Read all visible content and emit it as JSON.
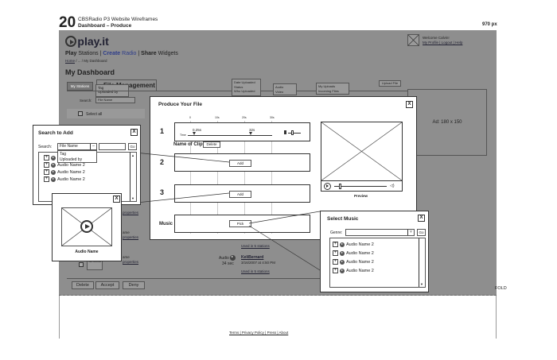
{
  "header": {
    "page_number": "20",
    "doc_title": "CBSRadio P3 Website Wireframes",
    "doc_subtitle": "Dashboard – Produce",
    "width_label": "970 px"
  },
  "site": {
    "logo_text": "play.it",
    "welcome": "Welcome Calvin!",
    "account_links": "My Profile | Logout | Help",
    "nav_play": "Play",
    "nav_stations": "Stations",
    "nav_create": "Create",
    "nav_radio": "Radio",
    "nav_share": "Share",
    "nav_widgets": "Widgets",
    "nav_sep": "|",
    "breadcrumb_home": "Home",
    "breadcrumb_rest": "/ ... / My Dashboard",
    "dashboard_title": "My Dashboard",
    "tab_stations": "My Stations",
    "tab_file_mgmt": "File Management",
    "tab_dropdown": [
      "Tag",
      "Uploaded by"
    ],
    "upload_date_items": [
      "Date Uploaded",
      "Status",
      "Who Uploaded"
    ],
    "audio_video_items": [
      "Audio",
      "Video"
    ],
    "my_uploads_items": [
      "My Uploads",
      "Incoming Files"
    ],
    "upload_file_button": "Upload File",
    "search_label": "Search:",
    "search_value": "File Name",
    "select_all": "Select all",
    "ad_text": "Ad: 180 x 150",
    "properties_link": "properties",
    "bg_audio_label": "Audio",
    "bg_duration": "34 sec",
    "bg_user": "KeliBernard",
    "bg_date": "3/16/2007 at 4:50 PM",
    "used_in_stations": "Used in 5 stations",
    "bg_row_name": "Sa 40x40",
    "bottom_buttons": [
      "Delete",
      "Accept",
      "Deny"
    ],
    "fold_label": "FOLD",
    "footer_links": "Terms | Privacy Policy | Press | About"
  },
  "produce_modal": {
    "title": "Produce Your File",
    "close": "X",
    "ruler_marks": [
      "0",
      "10s",
      "20s",
      "30s"
    ],
    "time_label": "Time",
    "time_start": "0.25s",
    "time_end": "32s",
    "rows": [
      "1",
      "2",
      "3"
    ],
    "name_of_clip": "Name of Clip",
    "delete_button": "Delete",
    "add_button": "Add",
    "music_label": "Music",
    "pick_button": "Pick",
    "preview_label": "Preview"
  },
  "search_modal": {
    "title": "Search to Add",
    "close": "X",
    "search_label": "Search:",
    "search_value": "File Name",
    "go_button": "Go",
    "dropdown_options": [
      "Tag",
      "Uploaded by"
    ],
    "items": [
      "Audio Name 2",
      "Audio Name 2",
      "Audio Name 2"
    ],
    "preview_close": "X",
    "preview_caption": "Audio Name"
  },
  "music_modal": {
    "title": "Select Music",
    "close": "X",
    "genre_label": "Genre:",
    "go_button": "Go",
    "items": [
      "Audio Name 2",
      "Audio Name 2",
      "Audio Name 2",
      "Audio Name 2"
    ]
  }
}
